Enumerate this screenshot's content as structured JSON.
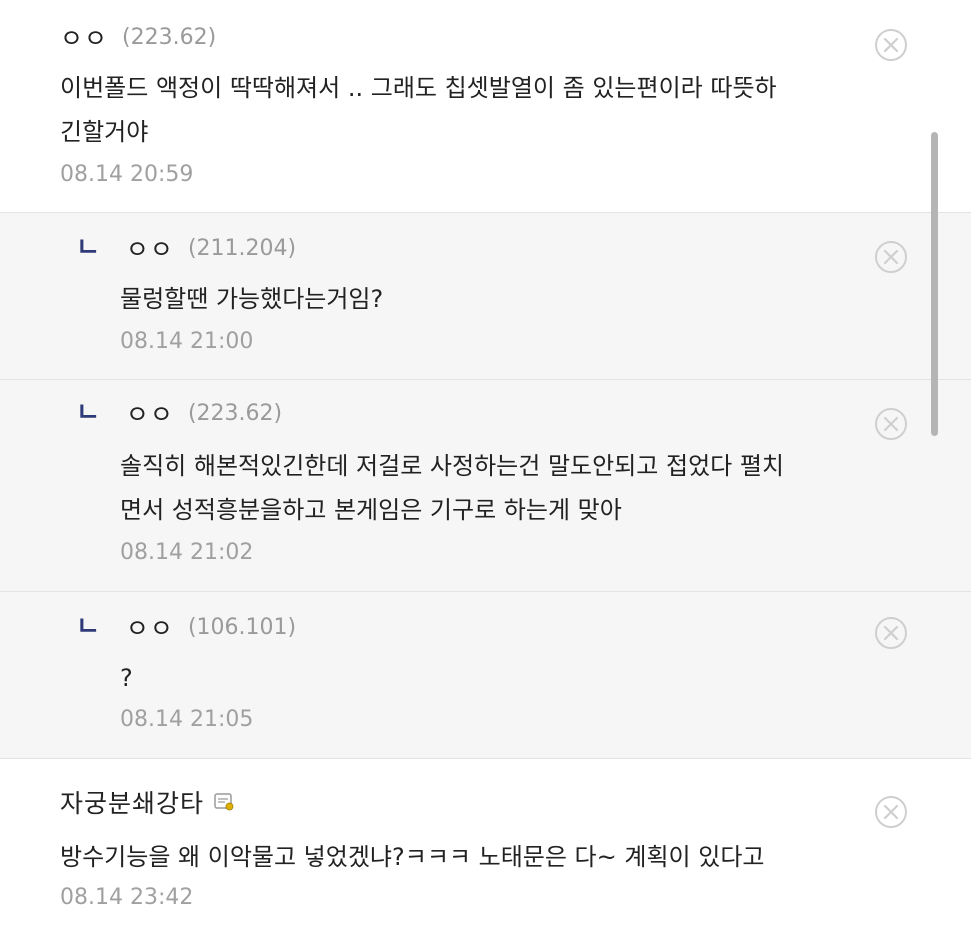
{
  "comments": [
    {
      "type": "root",
      "nickname": "ㅇㅇ",
      "ip": "(223.62)",
      "text": "이번폴드 액정이 딱딱해져서 .. 그래도 칩셋발열이 좀 있는편이라 따뜻하\n긴할거야",
      "time": "08.14 20:59"
    },
    {
      "type": "reply",
      "reply_mark": "ㄴ",
      "nickname": "ㅇㅇ",
      "ip": "(211.204)",
      "text": "물렁할땐 가능했다는거임?",
      "time": "08.14 21:00"
    },
    {
      "type": "reply",
      "reply_mark": "ㄴ",
      "nickname": "ㅇㅇ",
      "ip": "(223.62)",
      "text": "솔직히 해본적있긴한데 저걸로 사정하는건 말도안되고 접었다 펼치\n면서 성적흥분을하고 본게임은 기구로 하는게 맞아",
      "time": "08.14 21:02"
    },
    {
      "type": "reply",
      "reply_mark": "ㄴ",
      "nickname": "ㅇㅇ",
      "ip": "(106.101)",
      "text": "?",
      "time": "08.14 21:05"
    },
    {
      "type": "root",
      "nickname": "자궁분쇄강타",
      "ip": "",
      "writer_icon": "fixed-nick-icon",
      "text": "방수기능을 왜 이악물고 넣었겠냐?ㅋㅋㅋ 노태문은 다~ 계획이 있다고",
      "time": "08.14 23:42"
    }
  ],
  "icons": {
    "delete": "circle-x-icon",
    "writer": "fixed-nick-icon"
  },
  "colors": {
    "reply_mark": "#2f3a78",
    "reply_background": "#f6f6f7",
    "meta_gray": "#9a9a9a"
  }
}
